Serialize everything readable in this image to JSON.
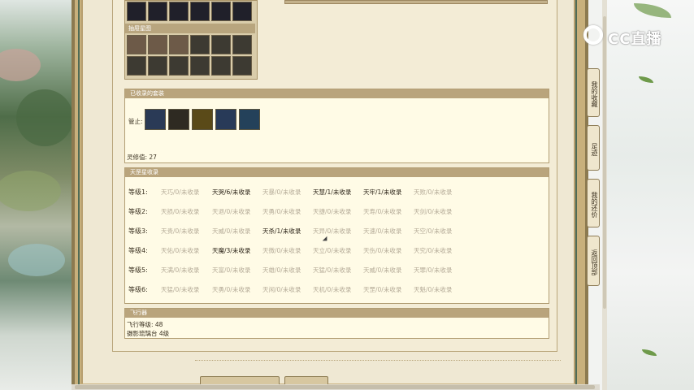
{
  "grid_top": {
    "section_title": "抽屉星图",
    "row1_icons": [
      "item-icon",
      "item-icon",
      "item-icon",
      "item-icon",
      "item-icon",
      "item-icon"
    ],
    "row2_icons": [
      "item-icon",
      "item-icon",
      "item-icon"
    ]
  },
  "collected": {
    "title": "已收录的套装",
    "label": "管止:",
    "score": "灵修值: 27"
  },
  "constellation": {
    "title": "天罡星收录",
    "rows": [
      {
        "level": "等级1:",
        "cells": [
          {
            "t": "天巧/0/未收录",
            "on": false
          },
          {
            "t": "天哭/6/未收录",
            "on": true
          },
          {
            "t": "天暴/0/未收录",
            "on": false
          },
          {
            "t": "天慧/1/未收录",
            "on": true
          },
          {
            "t": "天牢/1/未收录",
            "on": true
          },
          {
            "t": "天败/0/未收录",
            "on": false
          }
        ]
      },
      {
        "level": "等级2:",
        "cells": [
          {
            "t": "天损/0/未收录",
            "on": false
          },
          {
            "t": "天退/0/未收录",
            "on": false
          },
          {
            "t": "天勇/0/未收录",
            "on": false
          },
          {
            "t": "天捷/0/未收录",
            "on": false
          },
          {
            "t": "天寿/0/未收录",
            "on": false
          },
          {
            "t": "天剑/0/未收录",
            "on": false
          }
        ]
      },
      {
        "level": "等级3:",
        "cells": [
          {
            "t": "天贵/0/未收录",
            "on": false
          },
          {
            "t": "天威/0/未收录",
            "on": false
          },
          {
            "t": "天杀/1/未收录",
            "on": true
          },
          {
            "t": "天异/0/未收录",
            "on": false
          },
          {
            "t": "天速/0/未收录",
            "on": false
          },
          {
            "t": "天空/0/未收录",
            "on": false
          }
        ]
      },
      {
        "level": "等级4:",
        "cells": [
          {
            "t": "天佑/0/未收录",
            "on": false
          },
          {
            "t": "天魔/3/未收录",
            "on": true
          },
          {
            "t": "天微/0/未收录",
            "on": false
          },
          {
            "t": "天立/0/未收录",
            "on": false
          },
          {
            "t": "天伤/0/未收录",
            "on": false
          },
          {
            "t": "天究/0/未收录",
            "on": false
          }
        ]
      },
      {
        "level": "等级5:",
        "cells": [
          {
            "t": "天满/0/未收录",
            "on": false
          },
          {
            "t": "天富/0/未收录",
            "on": false
          },
          {
            "t": "天雄/0/未收录",
            "on": false
          },
          {
            "t": "天猛/0/未收录",
            "on": false
          },
          {
            "t": "天威/0/未收录",
            "on": false
          },
          {
            "t": "天罪/0/未收录",
            "on": false
          }
        ]
      },
      {
        "level": "等级6:",
        "cells": [
          {
            "t": "天猛/0/未收录",
            "on": false
          },
          {
            "t": "天勇/0/未收录",
            "on": false
          },
          {
            "t": "天闲/0/未收录",
            "on": false
          },
          {
            "t": "天机/0/未收录",
            "on": false
          },
          {
            "t": "天罡/0/未收录",
            "on": false
          },
          {
            "t": "天魁/0/未收录",
            "on": false
          }
        ]
      }
    ]
  },
  "flying": {
    "title": "飞行器",
    "level": "飞行等级: 48",
    "platform": "摄影琉璃台   4级"
  },
  "side_nav": {
    "my_collection": "我的收藏",
    "footprints": "足迹",
    "my_bids": "我的还价",
    "back_top": "返回顶部"
  },
  "logo": {
    "text": "CC直播"
  },
  "colors": {
    "accent": "#b9a47c",
    "frame": "#c8b07c",
    "paper": "#fffbe6"
  }
}
